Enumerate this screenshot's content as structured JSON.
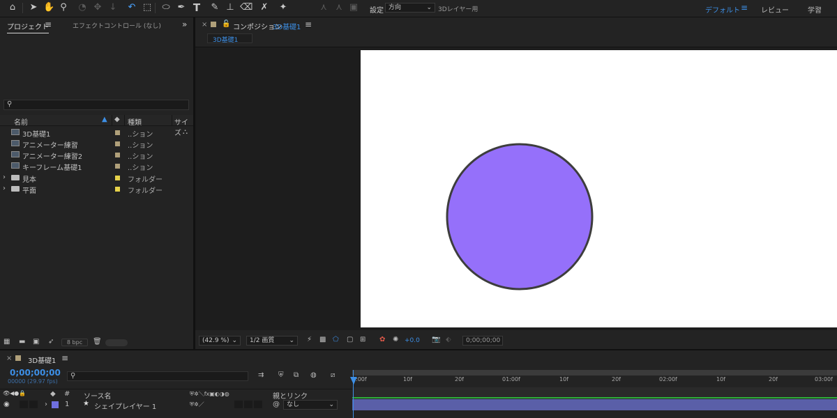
{
  "toolbar": {
    "settings_label": "設定",
    "direction_value": "方向",
    "layer3d_label": "3Dレイヤー用",
    "workspaces": [
      "デフォルト",
      "レビュー",
      "学習"
    ]
  },
  "project_panel": {
    "tab_project": "プロジェクト",
    "tab_effect": "エフェクトコントロール (なし)",
    "search_placeholder": "",
    "col_name": "名前",
    "col_type": "種類",
    "col_size": "サイズ",
    "items": [
      {
        "name": "3D基礎1",
        "type": "..ション",
        "kind": "comp",
        "color": "#b0a07a"
      },
      {
        "name": "アニメーター練習",
        "type": "..ション",
        "kind": "comp",
        "color": "#b0a07a"
      },
      {
        "name": "アニメーター練習2",
        "type": "..ション",
        "kind": "comp",
        "color": "#b0a07a"
      },
      {
        "name": "キーフレーム基礎1",
        "type": "..ション",
        "kind": "comp",
        "color": "#b0a07a"
      },
      {
        "name": "見本",
        "type": "フォルダー",
        "kind": "folder",
        "color": "#e6d24a"
      },
      {
        "name": "平面",
        "type": "フォルダー",
        "kind": "folder",
        "color": "#e6d24a"
      }
    ],
    "bpc": "8 bpc"
  },
  "comp_panel": {
    "tab_prefix": "コンポジション",
    "tab_name": "3D基礎1",
    "breadcrumb": "3D基礎1",
    "zoom": "(42.9 %)",
    "resolution": "1/2 画質",
    "exposure": "+0.0",
    "timecode": "0;00;00;00",
    "canvas_bg": "#ffffff",
    "circle_fill": "#9570fa",
    "circle_stroke": "#3d3d3d"
  },
  "timeline": {
    "tab_name": "3D基礎1",
    "timecode": "0;00;00;00",
    "frame_info": "00000 (29.97 fps)",
    "col_hash": "#",
    "col_source": "ソース名",
    "col_parent": "親とリンク",
    "ruler_ticks": [
      ":00f",
      "10f",
      "20f",
      "01:00f",
      "10f",
      "20f",
      "02:00f",
      "10f",
      "20f",
      "03:00f"
    ],
    "layers": [
      {
        "index": "1",
        "name": "シェイプレイヤー 1",
        "parent": "なし",
        "color": "#6f6fdf"
      }
    ]
  }
}
